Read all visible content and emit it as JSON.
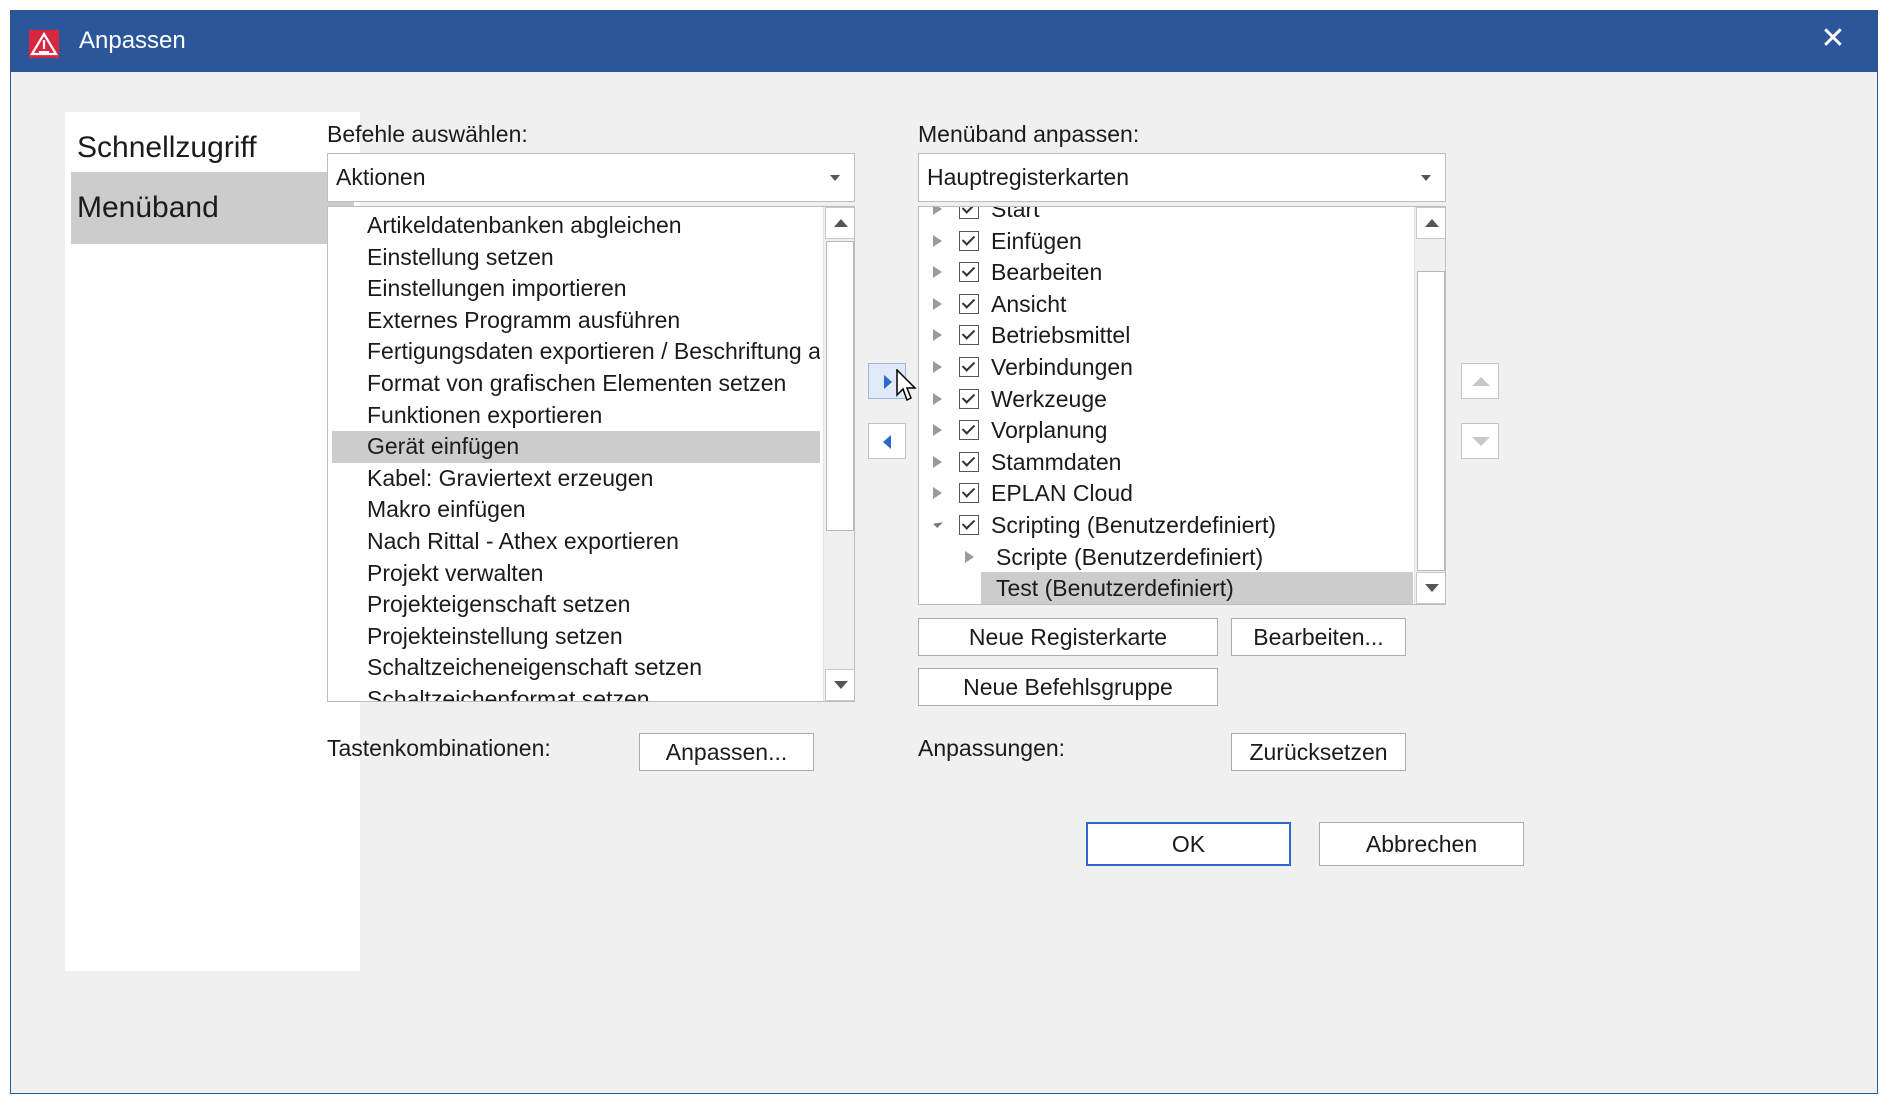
{
  "window": {
    "title": "Anpassen",
    "close_glyph": "✕",
    "logo_icon": "eplan-warning-logo-icon",
    "accent": "#2b579a"
  },
  "nav": {
    "items": [
      {
        "label": "Schnellzugriff"
      },
      {
        "label": "Menüband"
      }
    ],
    "selected": "Menüband"
  },
  "left": {
    "label": "Befehle auswählen:",
    "combo_value": "Aktionen",
    "items": [
      "Artikeldatenbanken abgleichen",
      "Einstellung setzen",
      "Einstellungen importieren",
      "Externes Programm ausführen",
      "Fertigungsdaten exportieren / Beschriftung ausgebı",
      "Format von grafischen Elementen setzen",
      "Funktionen exportieren",
      "Gerät einfügen",
      "Kabel: Graviertext erzeugen",
      "Makro einfügen",
      "Nach Rittal - Athex exportieren",
      "Projekt verwalten",
      "Projekteigenschaft setzen",
      "Projekteinstellung setzen",
      "Schaltzeicheneigenschaft setzen",
      "Schaltzeichenformat setzen"
    ],
    "selected_item": "Gerät einfügen"
  },
  "right": {
    "label": "Menüband anpassen:",
    "combo_value": "Hauptregisterkarten",
    "tree": [
      {
        "label": "Start",
        "level": 0,
        "checked": true,
        "expanded": false
      },
      {
        "label": "Einfügen",
        "level": 0,
        "checked": true,
        "expanded": false
      },
      {
        "label": "Bearbeiten",
        "level": 0,
        "checked": true,
        "expanded": false
      },
      {
        "label": "Ansicht",
        "level": 0,
        "checked": true,
        "expanded": false
      },
      {
        "label": "Betriebsmittel",
        "level": 0,
        "checked": true,
        "expanded": false
      },
      {
        "label": "Verbindungen",
        "level": 0,
        "checked": true,
        "expanded": false
      },
      {
        "label": "Werkzeuge",
        "level": 0,
        "checked": true,
        "expanded": false
      },
      {
        "label": "Vorplanung",
        "level": 0,
        "checked": true,
        "expanded": false
      },
      {
        "label": "Stammdaten",
        "level": 0,
        "checked": true,
        "expanded": false
      },
      {
        "label": "EPLAN Cloud",
        "level": 0,
        "checked": true,
        "expanded": false
      },
      {
        "label": "Scripting (Benutzerdefiniert)",
        "level": 0,
        "checked": true,
        "expanded": true
      },
      {
        "label": "Scripte (Benutzerdefiniert)",
        "level": 1,
        "expanded": false
      },
      {
        "label": "Test (Benutzerdefiniert)",
        "level": 1,
        "selected": true
      }
    ]
  },
  "buttons": {
    "new_tab": "Neue Registerkarte",
    "edit": "Bearbeiten...",
    "new_group": "Neue Befehlsgruppe",
    "shortcuts_label": "Tastenkombinationen:",
    "customize": "Anpassen...",
    "customizations_label": "Anpassungen:",
    "reset": "Zurücksetzen",
    "ok": "OK",
    "cancel": "Abbrechen"
  }
}
